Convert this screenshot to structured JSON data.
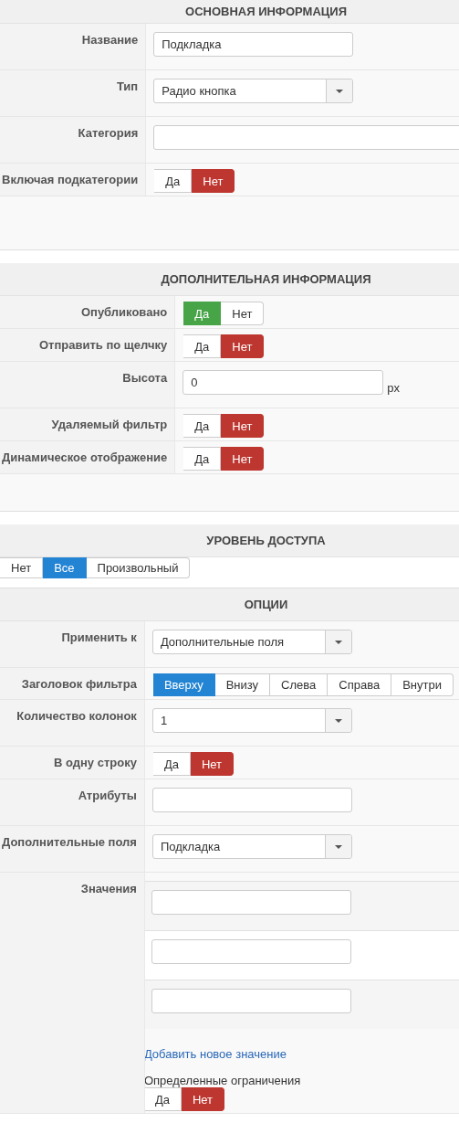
{
  "sections": [
    {
      "title": "ОСНОВНАЯ ИНФОРМАЦИЯ",
      "kind": "form",
      "fields": [
        {
          "kind": "text",
          "label": "Название",
          "value": "Подкладка"
        },
        {
          "kind": "select",
          "label": "Тип",
          "value": "Радио кнопка"
        },
        {
          "kind": "wide-text",
          "label": "Категория"
        },
        {
          "kind": "yesno",
          "label": "Включая подкатегории",
          "options": [
            {
              "label": "Да",
              "selected": false
            },
            {
              "label": "Нет",
              "selected": true
            }
          ]
        }
      ]
    },
    {
      "title": "ДОПОЛНИТЕЛЬНАЯ ИНФОРМАЦИЯ",
      "kind": "form",
      "fields": [
        {
          "kind": "yesno",
          "label": "Опубликовано",
          "options": [
            {
              "label": "Да",
              "selected": true
            },
            {
              "label": "Нет",
              "selected": false
            }
          ]
        },
        {
          "kind": "yesno",
          "label": "Отправить по щелчку",
          "options": [
            {
              "label": "Да",
              "selected": false
            },
            {
              "label": "Нет",
              "selected": true
            }
          ]
        },
        {
          "kind": "text",
          "label": "Высота",
          "value": "0",
          "unit": "px"
        },
        {
          "kind": "yesno",
          "label": "Удаляемый фильтр",
          "options": [
            {
              "label": "Да",
              "selected": false
            },
            {
              "label": "Нет",
              "selected": true
            }
          ]
        },
        {
          "kind": "yesno",
          "label": "Динамическое отображение",
          "options": [
            {
              "label": "Да",
              "selected": false
            },
            {
              "label": "Нет",
              "selected": true
            }
          ]
        }
      ]
    },
    {
      "title": "УРОВЕНЬ ДОСТУПА",
      "kind": "choices",
      "options": [
        {
          "label": "Нет",
          "selected": false
        },
        {
          "label": "Все",
          "selected": true
        },
        {
          "label": "Произвольный",
          "selected": false
        }
      ]
    },
    {
      "title": "ОПЦИИ",
      "kind": "form",
      "fields": [
        {
          "kind": "select",
          "label": "Применить к",
          "value": "Дополнительные поля"
        },
        {
          "kind": "choice",
          "label": "Заголовок фильтра",
          "options": [
            {
              "label": "Вверху",
              "selected": true
            },
            {
              "label": "Внизу",
              "selected": false
            },
            {
              "label": "Слева",
              "selected": false
            },
            {
              "label": "Справа",
              "selected": false
            },
            {
              "label": "Внутри",
              "selected": false
            }
          ]
        },
        {
          "kind": "select",
          "label": "Количество колонок",
          "value": "1"
        },
        {
          "kind": "yesno",
          "label": "В одну строку",
          "options": [
            {
              "label": "Да",
              "selected": false
            },
            {
              "label": "Нет",
              "selected": true
            }
          ]
        },
        {
          "kind": "text",
          "label": "Атрибуты"
        },
        {
          "kind": "select",
          "label": "Дополнительные поля",
          "value": "Подкладка"
        },
        {
          "kind": "values",
          "label": "Значения",
          "inputs": [
            {
              "kind": "text"
            },
            {
              "kind": "text"
            },
            {
              "kind": "text"
            }
          ],
          "link": "Добавить новое значение",
          "restriction": {
            "label": "Определенные ограничения",
            "options": [
              {
                "label": "Да",
                "selected": false
              },
              {
                "label": "Нет",
                "selected": true
              }
            ]
          }
        }
      ]
    }
  ]
}
